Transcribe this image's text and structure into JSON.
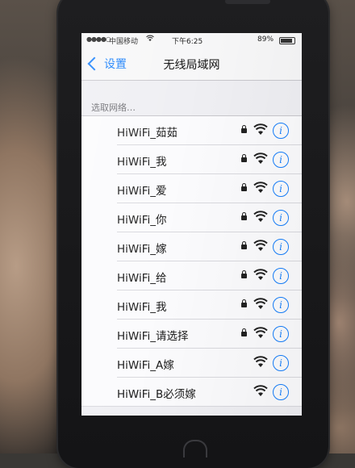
{
  "status_bar": {
    "signal": "●●●●○",
    "carrier": "中国移动",
    "time": "下午6:25",
    "battery": "89%"
  },
  "nav": {
    "back_label": "设置",
    "title": "无线局域网"
  },
  "section_header": "选取网络…",
  "networks": [
    {
      "name": "HiWiFi_茹茹",
      "locked": true
    },
    {
      "name": "HiWiFi_我",
      "locked": true
    },
    {
      "name": "HiWiFi_爱",
      "locked": true
    },
    {
      "name": "HiWiFi_你",
      "locked": true
    },
    {
      "name": "HiWiFi_嫁",
      "locked": true
    },
    {
      "name": "HiWiFi_给",
      "locked": true
    },
    {
      "name": "HiWiFi_我",
      "locked": true
    },
    {
      "name": "HiWiFi_请选择",
      "locked": true
    },
    {
      "name": "HiWiFi_A嫁",
      "locked": false
    },
    {
      "name": "HiWiFi_B必须嫁",
      "locked": false
    }
  ],
  "icons": {
    "lock": "lock-icon",
    "wifi": "wifi-icon",
    "info": "info-icon",
    "back": "chevron-left-icon"
  },
  "colors": {
    "accent": "#157efb",
    "background": "#efeff3"
  }
}
